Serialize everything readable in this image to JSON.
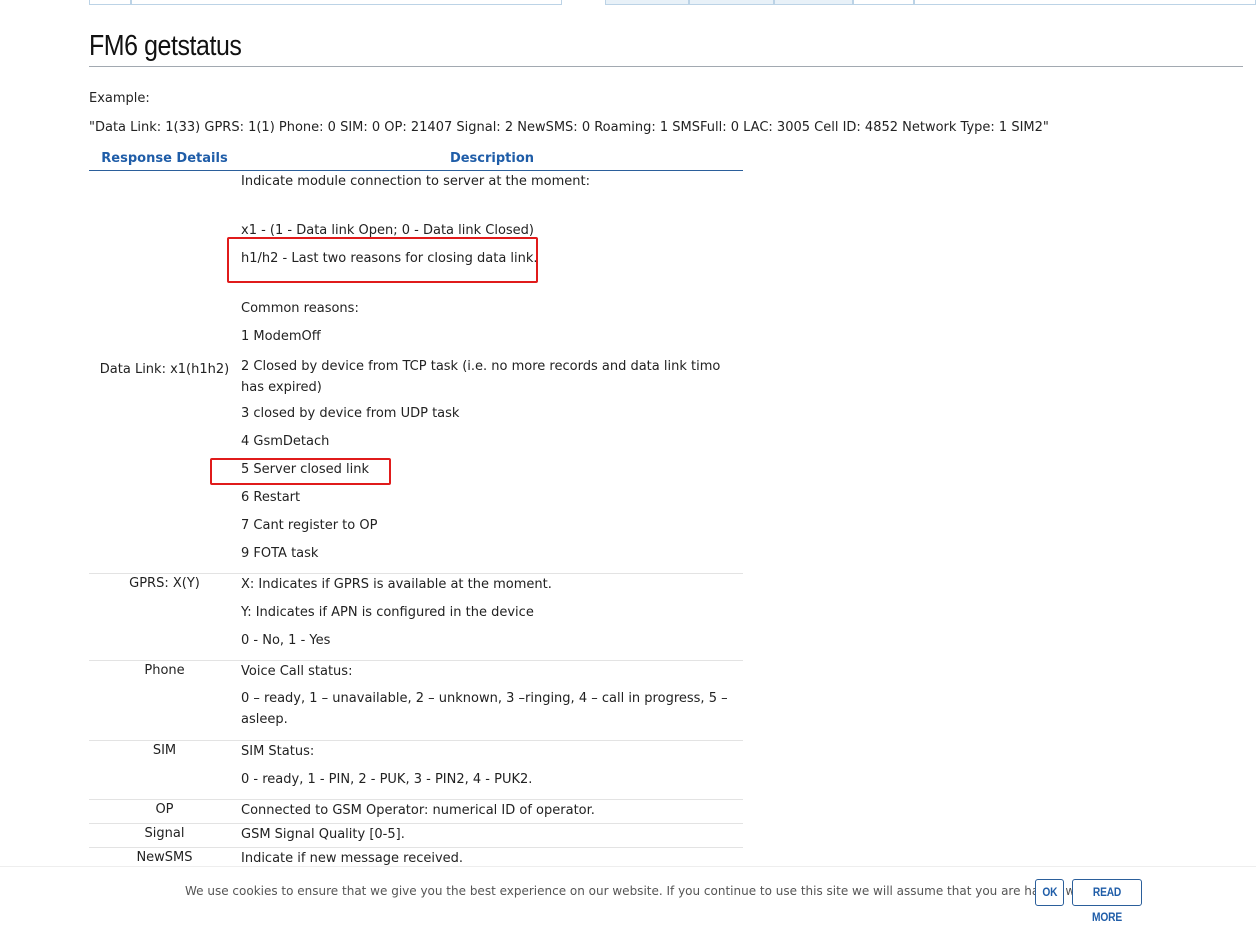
{
  "page": {
    "title": "FM6 getstatus",
    "example_label": "Example:",
    "example_text": "\"Data Link: 1(33) GPRS: 1(1) Phone: 0 SIM: 0 OP: 21407 Signal: 2 NewSMS: 0 Roaming: 1 SMSFull: 0 LAC: 3005 Cell ID: 4852 Network Type: 1 SIM2\""
  },
  "table": {
    "headers": [
      "Response Details",
      "Description"
    ],
    "rows": [
      {
        "name": "Data Link: x1(h1h2)",
        "lines": [
          "Indicate module connection to server at the moment:",
          "x1 - (1 - Data link Open; 0 - Data link Closed)",
          "h1/h2 - Last two reasons for closing data link.",
          "Common reasons:",
          "1 ModemOff",
          "2 Closed by device from TCP task (i.e. no more records and data link timo has expired)",
          "3 closed by device from UDP task",
          "4 GsmDetach",
          "5 Server closed link",
          "6 Restart",
          "7 Cant register to OP",
          "9 FOTA task"
        ]
      },
      {
        "name": "GPRS: X(Y)",
        "lines": [
          "X: Indicates if GPRS is available at the moment.",
          "Y: Indicates if APN is configured in the device",
          "0 - No, 1 - Yes"
        ]
      },
      {
        "name": "Phone",
        "lines": [
          "Voice Call status:",
          "0 – ready, 1 – unavailable, 2 – unknown, 3 –ringing, 4 – call in progress, 5 – asleep."
        ]
      },
      {
        "name": "SIM",
        "lines": [
          "SIM Status:",
          "0 - ready, 1 - PIN, 2 - PUK, 3 - PIN2, 4 - PUK2."
        ]
      },
      {
        "name": "OP",
        "lines": [
          "Connected to GSM Operator: numerical ID of operator."
        ]
      },
      {
        "name": "Signal",
        "lines": [
          "GSM Signal Quality [0-5]."
        ]
      },
      {
        "name": "NewSMS",
        "lines": [
          "Indicate if new message received."
        ]
      }
    ]
  },
  "cookie_bar": {
    "text": "We use cookies to ensure that we give you the best experience on our website. If you continue to use this site we will assume that you are happy with it.",
    "ok_label": "OK",
    "read_more_label": "READ MORE"
  },
  "colors": {
    "header_blue": "#1f5da8",
    "highlight_red": "#e01b1b"
  }
}
